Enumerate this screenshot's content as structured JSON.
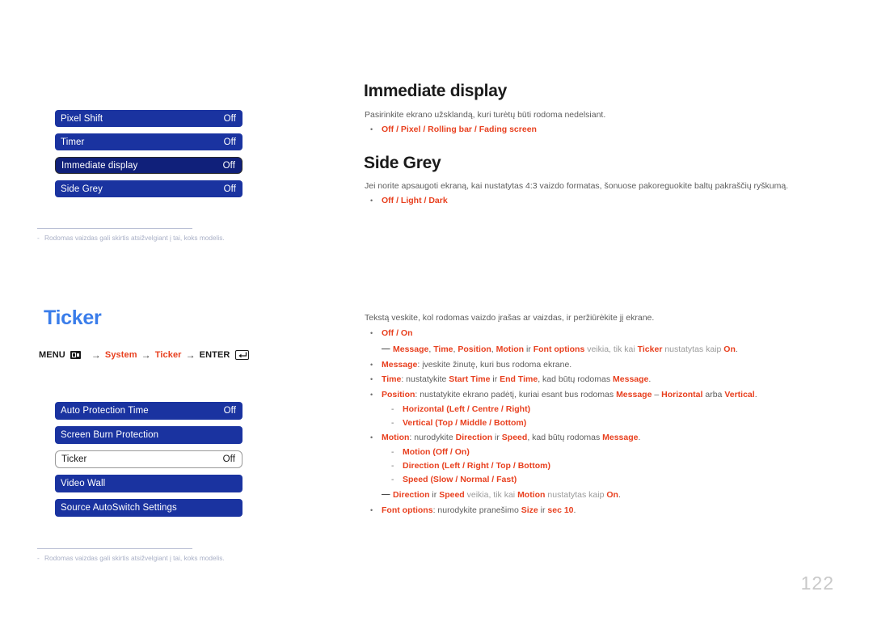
{
  "page": {
    "number": "122"
  },
  "left": {
    "osd_top": {
      "rows": [
        {
          "label": "Pixel Shift",
          "value": "Off",
          "state": "normal"
        },
        {
          "label": "Timer",
          "value": "Off",
          "state": "normal"
        },
        {
          "label": "Immediate display",
          "value": "Off",
          "state": "selected"
        },
        {
          "label": "Side Grey",
          "value": "Off",
          "state": "normal"
        }
      ]
    },
    "footnote_top": {
      "dash": "-",
      "text": "Rodomas vaizdas gali skirtis atsižvelgiant į tai, koks modelis."
    },
    "ticker_title": "Ticker",
    "menu_path": {
      "menu_label": "MENU",
      "menu_icon": "menu-icon",
      "arrow": "→",
      "item1": "System",
      "item2": "Ticker",
      "enter_label": "ENTER",
      "enter_icon": "enter-icon"
    },
    "osd_bottom": {
      "rows": [
        {
          "label": "Auto Protection Time",
          "value": "Off",
          "state": "normal"
        },
        {
          "label": "Screen Burn Protection",
          "value": "",
          "state": "normal"
        },
        {
          "label": "Ticker",
          "value": "Off",
          "state": "selected-light"
        },
        {
          "label": "Video Wall",
          "value": "",
          "state": "normal"
        },
        {
          "label": "Source AutoSwitch Settings",
          "value": "",
          "state": "normal"
        }
      ]
    },
    "footnote_bottom": {
      "dash": "-",
      "text": "Rodomas vaizdas gali skirtis atsižvelgiant į tai, koks modelis."
    }
  },
  "right": {
    "immediate_display": {
      "title": "Immediate display",
      "desc": "Pasirinkite ekrano užsklandą, kuri turėtų būti rodoma nedelsiant.",
      "bullet": "•",
      "options": "Off / Pixel / Rolling bar / Fading screen"
    },
    "side_grey": {
      "title": "Side Grey",
      "desc": "Jei norite apsaugoti ekraną, kai nustatytas 4:3 vaizdo formatas, šonuose pakoreguokite baltų pakraščių ryškumą.",
      "bullet": "•",
      "options": "Off / Light / Dark"
    },
    "ticker": {
      "desc": "Tekstą veskite, kol rodomas vaizdo įrašas ar vaizdas, ir peržiūrėkite jį ekrane.",
      "bullet": "•",
      "subdash": "-",
      "notemark": "―",
      "b1_options": "Off / On",
      "note1": {
        "t1": "Message",
        "sep1": ", ",
        "t2": "Time",
        "sep2": ", ",
        "t3": "Position",
        "sep3": ", ",
        "t4": "Motion",
        "mid1": " ir ",
        "t5": "Font options",
        "mid2": " veikia, tik kai ",
        "t6": "Ticker",
        "mid3": " nustatytas kaip ",
        "t7": "On",
        "end": "."
      },
      "b_message": {
        "term": "Message",
        "rest": ": įveskite žinutę, kuri bus rodoma ekrane."
      },
      "b_time": {
        "term": "Time",
        "mid1": ": nustatykite ",
        "t1": "Start Time",
        "mid2": " ir ",
        "t2": "End Time",
        "mid3": ", kad būtų rodomas ",
        "t3": "Message",
        "end": "."
      },
      "b_position": {
        "term": "Position",
        "mid1": ": nustatykite ekrano padėtį, kuriai esant bus rodomas ",
        "t1": "Message",
        "mid2": " – ",
        "t2": "Horizontal",
        "mid3": " arba ",
        "t3": "Vertical",
        "end": "."
      },
      "sub_horizontal": {
        "term": "Horizontal",
        "opts": "(Left / Centre / Right)"
      },
      "sub_vertical": {
        "term": "Vertical",
        "opts": "(Top / Middle / Bottom)"
      },
      "b_motion": {
        "term": "Motion",
        "mid1": ": nurodykite ",
        "t1": "Direction",
        "mid2": " ir ",
        "t2": "Speed",
        "mid3": ", kad būtų rodomas ",
        "t3": "Message",
        "end": "."
      },
      "sub_motion": {
        "term": "Motion",
        "opts": "(Off / On)"
      },
      "sub_direction": {
        "term": "Direction",
        "opts": "(Left / Right / Top / Bottom)"
      },
      "sub_speed": {
        "term": "Speed",
        "opts": "(Slow / Normal / Fast)"
      },
      "note2": {
        "t1": "Direction",
        "mid1": " ir ",
        "t2": "Speed",
        "mid2": " veikia, tik kai ",
        "t3": "Motion",
        "mid3": " nustatytas kaip ",
        "t4": "On",
        "end": "."
      },
      "b_font": {
        "term": "Font options",
        "mid1": ": nurodykite pranešimo ",
        "t1": "Size",
        "mid2": " ir ",
        "t2": "sec 10",
        "end": "."
      }
    }
  },
  "colors": {
    "osd_blue": "#1a33a0",
    "osd_blue_selected": "#10207a",
    "accent_red": "#e8401f",
    "title_blue": "#3a7dea",
    "body_gray": "#5d5d5d",
    "footnote_gray": "#a9b0c6",
    "page_number_gray": "#c9c9c9"
  }
}
